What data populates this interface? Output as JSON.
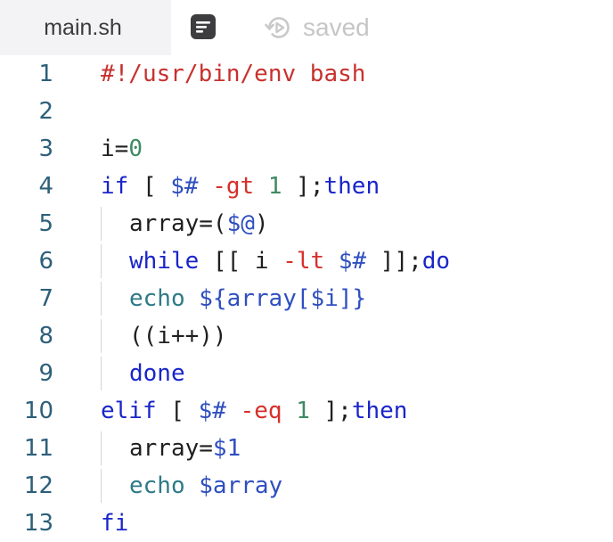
{
  "tab": {
    "label": "main.sh"
  },
  "status": {
    "saved_label": "saved"
  },
  "editor": {
    "lines": [
      {
        "number": "1",
        "indent": false,
        "tokens": [
          {
            "t": "#!/usr/bin/env bash",
            "c": "shebang"
          }
        ]
      },
      {
        "number": "2",
        "indent": false,
        "tokens": []
      },
      {
        "number": "3",
        "indent": false,
        "tokens": [
          {
            "t": "i=",
            "c": "plain"
          },
          {
            "t": "0",
            "c": "num"
          }
        ]
      },
      {
        "number": "4",
        "indent": false,
        "tokens": [
          {
            "t": "if",
            "c": "kw"
          },
          {
            "t": " [ ",
            "c": "plain"
          },
          {
            "t": "$#",
            "c": "var"
          },
          {
            "t": " ",
            "c": "plain"
          },
          {
            "t": "-gt",
            "c": "op"
          },
          {
            "t": " ",
            "c": "plain"
          },
          {
            "t": "1",
            "c": "num"
          },
          {
            "t": " ];",
            "c": "plain"
          },
          {
            "t": "then",
            "c": "kw"
          }
        ]
      },
      {
        "number": "5",
        "indent": true,
        "tokens": [
          {
            "t": "array=(",
            "c": "plain"
          },
          {
            "t": "$@",
            "c": "var"
          },
          {
            "t": ")",
            "c": "plain"
          }
        ]
      },
      {
        "number": "6",
        "indent": true,
        "tokens": [
          {
            "t": "while",
            "c": "kw"
          },
          {
            "t": " [[ i ",
            "c": "plain"
          },
          {
            "t": "-lt",
            "c": "op"
          },
          {
            "t": " ",
            "c": "plain"
          },
          {
            "t": "$#",
            "c": "var"
          },
          {
            "t": " ]];",
            "c": "plain"
          },
          {
            "t": "do",
            "c": "kw"
          }
        ]
      },
      {
        "number": "7",
        "indent": true,
        "tokens": [
          {
            "t": "echo",
            "c": "cmd"
          },
          {
            "t": " ",
            "c": "plain"
          },
          {
            "t": "${array[$i]}",
            "c": "var"
          }
        ]
      },
      {
        "number": "8",
        "indent": true,
        "tokens": [
          {
            "t": "((i++))",
            "c": "plain"
          }
        ]
      },
      {
        "number": "9",
        "indent": true,
        "tokens": [
          {
            "t": "done",
            "c": "kw"
          }
        ]
      },
      {
        "number": "10",
        "indent": false,
        "tokens": [
          {
            "t": "elif",
            "c": "kw"
          },
          {
            "t": " [ ",
            "c": "plain"
          },
          {
            "t": "$#",
            "c": "var"
          },
          {
            "t": " ",
            "c": "plain"
          },
          {
            "t": "-eq",
            "c": "op"
          },
          {
            "t": " ",
            "c": "plain"
          },
          {
            "t": "1",
            "c": "num"
          },
          {
            "t": " ];",
            "c": "plain"
          },
          {
            "t": "then",
            "c": "kw"
          }
        ]
      },
      {
        "number": "11",
        "indent": true,
        "tokens": [
          {
            "t": "array=",
            "c": "plain"
          },
          {
            "t": "$1",
            "c": "var"
          }
        ]
      },
      {
        "number": "12",
        "indent": true,
        "tokens": [
          {
            "t": "echo",
            "c": "cmd"
          },
          {
            "t": " ",
            "c": "plain"
          },
          {
            "t": "$array",
            "c": "var"
          }
        ]
      },
      {
        "number": "13",
        "indent": false,
        "tokens": [
          {
            "t": "fi",
            "c": "kw"
          }
        ]
      }
    ]
  },
  "colors": {
    "shebang": "#c7322e",
    "keyword": "#1a25c9",
    "number": "#3f8a62",
    "operator": "#d6302a",
    "variable": "#2f4fc0",
    "command": "#2d7a87",
    "line_number": "#2d5f7a"
  },
  "icons": {
    "format": "format-icon",
    "saved": "history-icon"
  }
}
